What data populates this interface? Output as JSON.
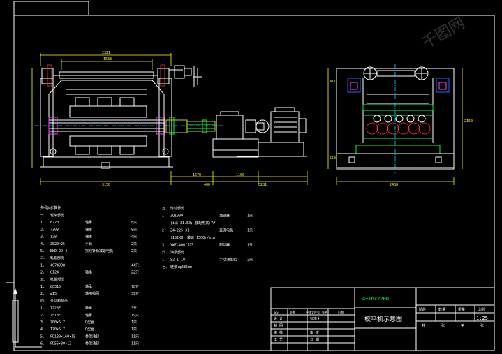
{
  "dims": {
    "front_top_total": "2321",
    "front_top_inner": "1538",
    "front_bottom_total": "3150",
    "front_bottom_a": "1670",
    "front_bottom_b": "400",
    "front_bottom_c": "1100",
    "front_bottom_d": "3281",
    "side_bottom": "2438",
    "side_height": "2150",
    "side_left_a": "411",
    "side_left_b": "550"
  },
  "notes": {
    "left_title": "外购标准件：",
    "left_lines": [
      {
        "num": "一、",
        "name": "辊架部份",
        "type": "",
        "qty": ""
      },
      {
        "num": "1.",
        "name": "8220",
        "type": "轴承",
        "qty": "8只"
      },
      {
        "num": "2.",
        "name": "7308",
        "type": "轴承",
        "qty": "8只"
      },
      {
        "num": "3.",
        "name": "128",
        "type": "轴承",
        "qty": "4只"
      },
      {
        "num": "4.",
        "name": "Z520×25",
        "type": "手轮",
        "qty": "2只"
      },
      {
        "num": "5.",
        "name": "BWD-29-4",
        "type": "摆线针轮减速电机",
        "qty": "2只"
      },
      {
        "num": "二、",
        "name": "轧辊部份",
        "type": "",
        "qty": ""
      },
      {
        "num": "1.",
        "name": "4074938",
        "type": "",
        "qty": "44只"
      },
      {
        "num": "2.",
        "name": "8124",
        "type": "轴承",
        "qty": "22只"
      },
      {
        "num": "三、",
        "name": "托辊部份",
        "type": "",
        "qty": ""
      },
      {
        "num": "1.",
        "name": "80315",
        "type": "轴承",
        "qty": "78只"
      },
      {
        "num": "2.",
        "name": "φ15",
        "type": "轴用挡圈",
        "qty": "39只"
      },
      {
        "num": "四、",
        "name": "分动箱部份",
        "type": "",
        "qty": ""
      },
      {
        "num": "1.",
        "name": "7228E",
        "type": "轴承",
        "qty": "3只"
      },
      {
        "num": "2.",
        "name": "7518E",
        "type": "轴承",
        "qty": "19只"
      },
      {
        "num": "3.",
        "name": "Z00×5.7",
        "type": "O型圈",
        "qty": "1只"
      },
      {
        "num": "4.",
        "name": "170×5.7",
        "type": "O型圈",
        "qty": "1只"
      },
      {
        "num": "5.",
        "name": "PD130×160×15",
        "type": "骨架油封",
        "qty": "11只"
      },
      {
        "num": "6.",
        "name": "PD55×80×12",
        "type": "骨架油封",
        "qty": "11只"
      }
    ],
    "right_lines": [
      {
        "num": "五、",
        "name": "传动部份",
        "type": "",
        "qty": ""
      },
      {
        "num": "1.",
        "name": "ZQ1000",
        "type": "减速器",
        "qty": "1只"
      },
      {
        "num": "",
        "name": "(i比:31.50; 装配形式:7#)",
        "type": "",
        "qty": ""
      },
      {
        "num": "2.",
        "name": "Z4-225-31",
        "type": "直流电机",
        "qty": "1只"
      },
      {
        "num": "",
        "name": "(132KW, 转速:1500r/min)",
        "type": "",
        "qty": ""
      },
      {
        "num": "3.",
        "name": "YWZ-400/125",
        "type": "制动器",
        "qty": "1只"
      },
      {
        "num": "六、",
        "name": "油泵部份",
        "type": "",
        "qty": ""
      },
      {
        "num": "1.",
        "name": "S2-1-10",
        "type": "手动油泵组",
        "qty": "2只"
      },
      {
        "num": "七、",
        "name": "链条:φ635mm",
        "type": "",
        "qty": ""
      }
    ]
  },
  "title_block": {
    "spec": "4~16×2200",
    "drawing_name": "校平机示意图",
    "row_labels": [
      "设 计",
      "制 图",
      "审 核",
      "工 艺"
    ],
    "mid_labels": [
      "标准化",
      "审 定",
      "日 期"
    ],
    "header_cells": [
      "阶段",
      "数量",
      "重量",
      "比例"
    ],
    "scale": "1:25",
    "sheet_cells": [
      "共",
      "张",
      "第",
      "张"
    ],
    "top_row": [
      "标记",
      "处数",
      "更改文件号",
      "签名",
      "日期"
    ]
  },
  "watermark": "千图网"
}
